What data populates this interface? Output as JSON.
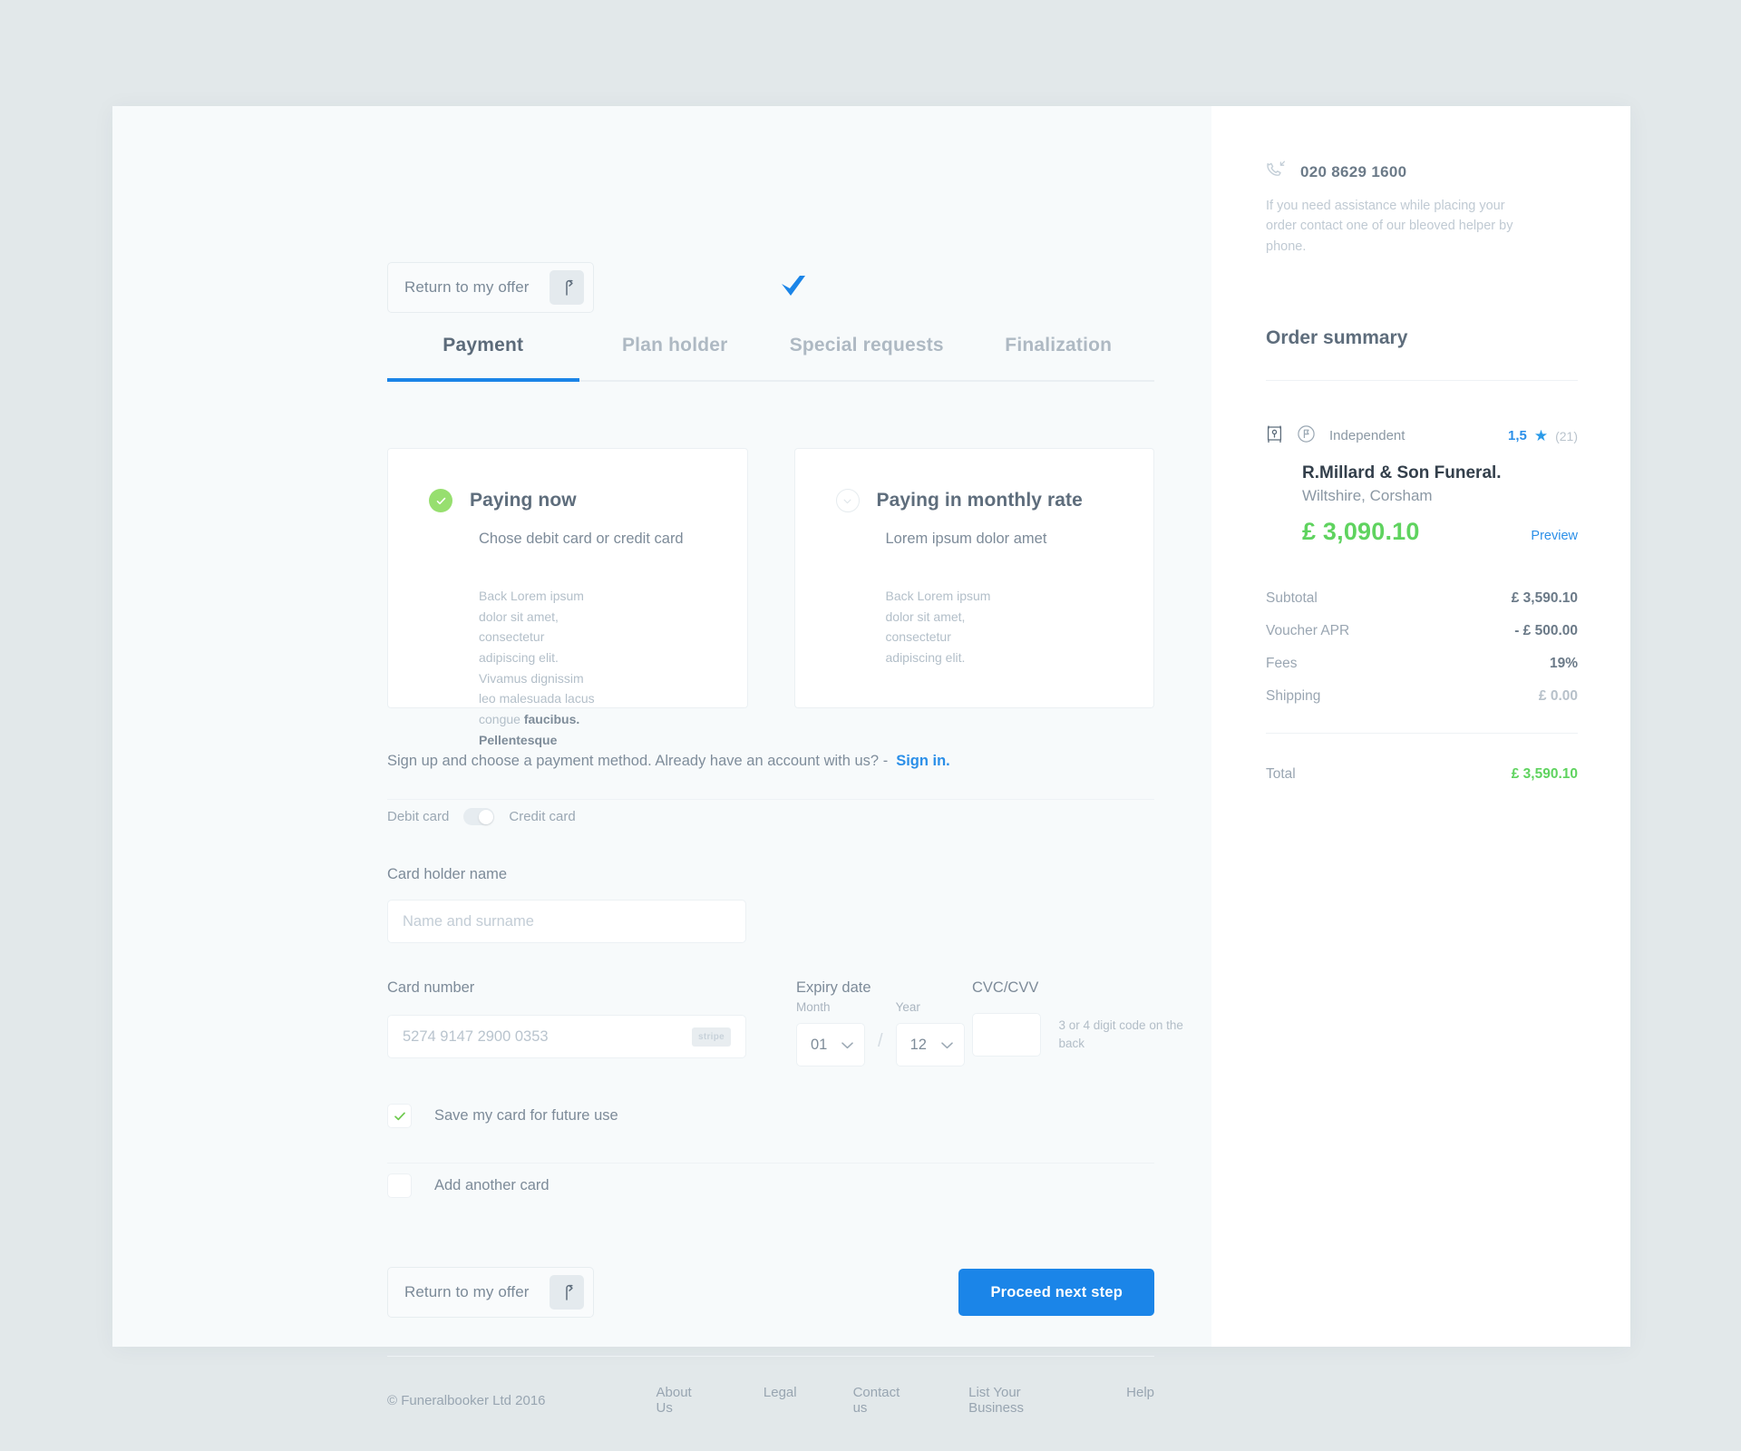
{
  "header": {
    "return_button_label": "Return to my offer",
    "return_icon": "return-arrow-icon",
    "brand_icon": "blue-checkmark-logo"
  },
  "tabs": [
    {
      "label": "Payment",
      "active": true
    },
    {
      "label": "Plan holder",
      "active": false
    },
    {
      "label": "Special requests",
      "active": false
    },
    {
      "label": "Finalization",
      "active": false
    }
  ],
  "payment_options": [
    {
      "title": "Paying now",
      "subtitle": "Chose debit card or credit card",
      "fine_text": "Back Lorem ipsum dolor sit amet, consectetur adipiscing elit. Vivamus dignissim leo malesuada lacus congue ",
      "fine_bold": "faucibus. Pellentesque",
      "selected": true
    },
    {
      "title": "Paying in monthly rate",
      "subtitle": "Lorem ipsum dolor amet",
      "fine_text": "Back Lorem ipsum dolor sit amet, consectetur adipiscing elit.",
      "fine_bold": "",
      "selected": false
    }
  ],
  "signup": {
    "text": "Sign up and choose a payment method. Already have an account with us?  -",
    "link": "Sign in."
  },
  "card_type": {
    "left_label": "Debit card",
    "right_label": "Credit card",
    "state": "credit"
  },
  "form": {
    "holder_label": "Card holder name",
    "holder_placeholder": "Name and surname",
    "holder_value": "",
    "number_label": "Card number",
    "number_placeholder": "5274 9147 2900 0353",
    "number_value": "",
    "stripe_badge": "stripe",
    "expiry_label": "Expiry date",
    "month_label": "Month",
    "month_value": "01",
    "separator": "/",
    "year_label": "Year",
    "year_value": "12",
    "cvc_label": "CVC/CVV",
    "cvc_value": "",
    "cvc_hint": "3 or 4 digit code on the back"
  },
  "checkboxes": [
    {
      "label": "Save my card for future use",
      "checked": true
    },
    {
      "label": "Add another card",
      "checked": false
    }
  ],
  "actions": {
    "return_label": "Return to my offer",
    "proceed_label": "Proceed next step"
  },
  "footer": {
    "copyright": "© Funeralbooker Ltd 2016",
    "links": [
      "About Us",
      "Legal",
      "Contact us",
      "List Your Business",
      "Help"
    ]
  },
  "sidebar": {
    "phone_icon": "phone-incoming-icon",
    "phone_number": "020 8629 1600",
    "phone_help": "If you need assistance while placing your order contact one of our bleoved helper by phone.",
    "order_summary_title": "Order summary",
    "vendor": {
      "map_icon": "map-pin-icon",
      "type_icon": "flag-circle-icon",
      "type_label": "Independent",
      "rating_score": "1,5",
      "rating_star": "★",
      "rating_count": "(21)",
      "name": "R.Millard & Son Funeral.",
      "location": "Wiltshire, Corsham",
      "price": "£ 3,090.10",
      "preview_label": "Preview"
    },
    "breakdown": [
      {
        "key": "Subtotal",
        "value": "£ 3,590.10",
        "muted": false
      },
      {
        "key": "Voucher APR",
        "value": "- £ 500.00",
        "muted": false
      },
      {
        "key": "Fees",
        "value": "19%",
        "muted": false
      },
      {
        "key": "Shipping",
        "value": "£ 0.00",
        "muted": true
      }
    ],
    "total_label": "Total",
    "total_value": "£ 3,590.10"
  },
  "colors": {
    "accent_blue": "#1b85e8",
    "green": "#5fd35f",
    "radio_green": "#97df6f",
    "page_bg": "#e2e8ea",
    "panel_bg": "#f7fafb"
  }
}
